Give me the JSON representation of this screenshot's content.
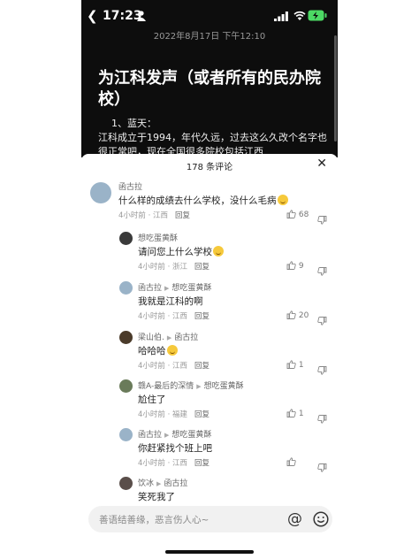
{
  "status": {
    "time": "17:23"
  },
  "article": {
    "date": "2022年8月17日 下午12:10",
    "title": "为江科发声（或者所有的民办院校）",
    "subtitle": "1、蓝天：",
    "body": "江科成立于1994，年代久远，过去这么久改个名字也很正常吧，现在全国很多院校包括江西"
  },
  "comments_header": {
    "title": "178 条评论"
  },
  "comments": [
    {
      "name": "函古拉",
      "reply_to": "",
      "text": "什么样的成绩去什么学校，没什么毛病",
      "emoji": true,
      "time": "4小时前 · 江西",
      "reply": "回复",
      "likes": "68",
      "avatar_color": "#9ab3c8"
    },
    {
      "name": "想吃蛋黄酥",
      "reply_to": "",
      "text": "请问您上什么学校",
      "emoji": true,
      "time": "4小时前 · 浙江",
      "reply": "回复",
      "likes": "9",
      "avatar_color": "#3a3a3a"
    },
    {
      "name": "函古拉",
      "reply_to": "想吃蛋黄酥",
      "text": "我就是江科的啊",
      "emoji": false,
      "time": "4小时前 · 江西",
      "reply": "回复",
      "likes": "20",
      "avatar_color": "#9ab3c8"
    },
    {
      "name": "梁山伯.",
      "reply_to": "函古拉",
      "text": "哈哈哈",
      "emoji": true,
      "time": "4小时前 · 江西",
      "reply": "回复",
      "likes": "1",
      "avatar_color": "#4b3b2a"
    },
    {
      "name": "赣A-最后的深情",
      "reply_to": "想吃蛋黄酥",
      "text": "尬住了",
      "emoji": false,
      "time": "4小时前 · 福建",
      "reply": "回复",
      "likes": "1",
      "avatar_color": "#6a7b5a"
    },
    {
      "name": "函古拉",
      "reply_to": "想吃蛋黄酥",
      "text": "你赶紧找个班上吧",
      "emoji": false,
      "time": "4小时前 · 江西",
      "reply": "回复",
      "likes": "",
      "avatar_color": "#9ab3c8"
    },
    {
      "name": "饮冰",
      "reply_to": "函古拉",
      "text": "笑死我了",
      "emoji": false,
      "time": "",
      "reply": "",
      "likes": "",
      "avatar_color": "#5a4e4a"
    }
  ],
  "input": {
    "placeholder": "善语结善缘，恶言伤人心~"
  }
}
